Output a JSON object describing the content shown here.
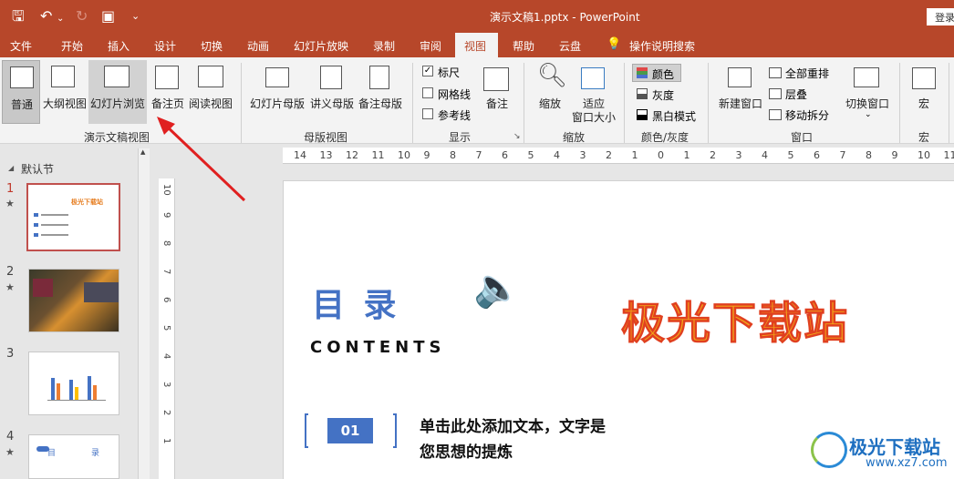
{
  "titlebar": {
    "doc_title": "演示文稿1.pptx  -  PowerPoint",
    "login": "登录"
  },
  "tabs": [
    "文件",
    "开始",
    "插入",
    "设计",
    "切换",
    "动画",
    "幻灯片放映",
    "录制",
    "审阅",
    "视图",
    "帮助",
    "云盘"
  ],
  "tell_me": "操作说明搜索",
  "ribbon": {
    "pres_views": {
      "normal": "普通",
      "outline": "大纲视图",
      "sorter": "幻灯片浏览",
      "notes_page": "备注页",
      "reading": "阅读视图",
      "label": "演示文稿视图"
    },
    "master_views": {
      "slide_master": "幻灯片母版",
      "handout_master": "讲义母版",
      "notes_master": "备注母版",
      "label": "母版视图"
    },
    "show": {
      "ruler": "标尺",
      "gridlines": "网格线",
      "guides": "参考线",
      "notes": "备注",
      "label": "显示"
    },
    "zoom": {
      "zoom": "缩放",
      "fit": "适应\n窗口大小",
      "label": "缩放"
    },
    "color": {
      "color": "颜色",
      "grayscale": "灰度",
      "bw": "黑白模式",
      "label": "颜色/灰度"
    },
    "window": {
      "new": "新建窗口",
      "arrange": "全部重排",
      "cascade": "层叠",
      "move_split": "移动拆分",
      "switch": "切换窗口",
      "label": "窗口"
    },
    "macros": {
      "macros": "宏",
      "label": "宏"
    }
  },
  "sidebar": {
    "section": "默认节",
    "slides": [
      {
        "num": "1",
        "title": "极光下载站"
      },
      {
        "num": "2"
      },
      {
        "num": "3"
      },
      {
        "num": "4",
        "title_left": "目",
        "title_right": "录"
      }
    ]
  },
  "ruler": {
    "h_labels": [
      "14",
      "13",
      "12",
      "11",
      "10",
      "9",
      "8",
      "7",
      "6",
      "5",
      "4",
      "3",
      "2",
      "1",
      "0",
      "1",
      "2",
      "3",
      "4",
      "5",
      "6",
      "7",
      "8",
      "9",
      "10",
      "11"
    ],
    "v_labels": [
      "10",
      "9",
      "8",
      "7",
      "6",
      "5",
      "4",
      "3",
      "2",
      "1"
    ]
  },
  "slide": {
    "heading": "目  录",
    "subheading": "CONTENTS",
    "brand": "极光下载站",
    "item_num": "01",
    "item_line1": "单击此处添加文本，文字是",
    "item_line2": "您思想的提炼"
  },
  "watermark": {
    "name": "极光下载站",
    "url": "www.xz7.com"
  }
}
